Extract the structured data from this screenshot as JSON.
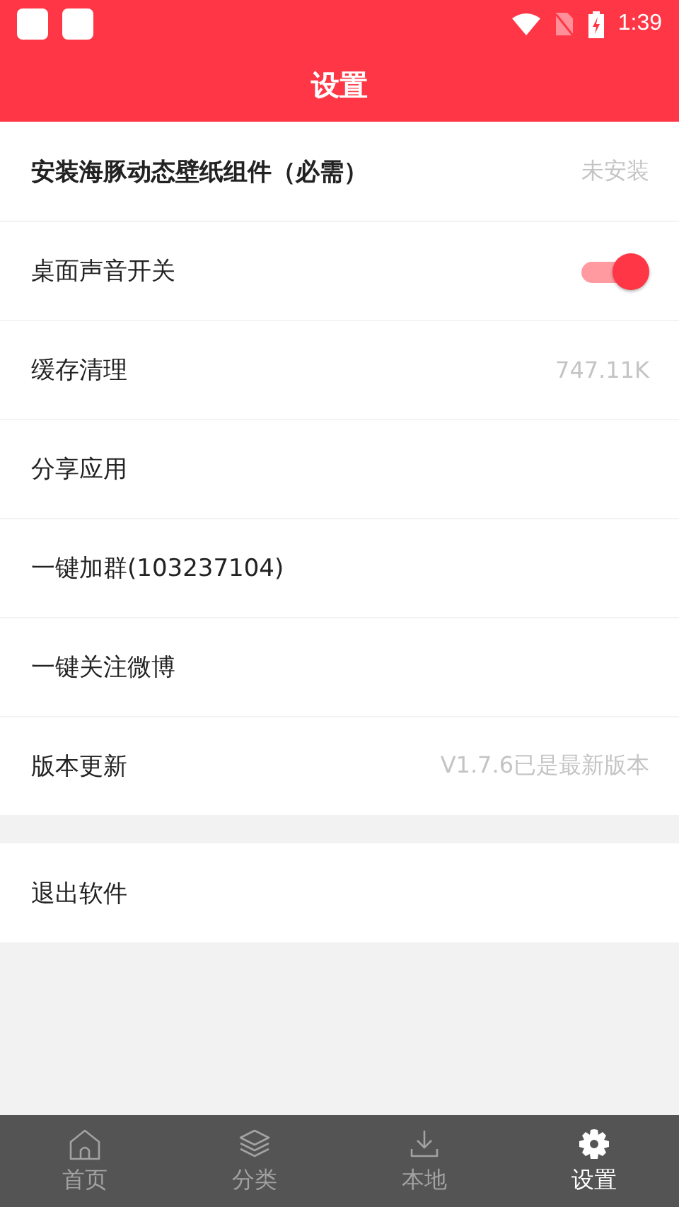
{
  "status_bar": {
    "time": "1:39"
  },
  "header": {
    "title": "设置"
  },
  "settings": [
    {
      "kind": "value",
      "label": "安装海豚动态壁纸组件（必需）",
      "bold": true,
      "value": "未安装"
    },
    {
      "kind": "toggle",
      "label": "桌面声音开关",
      "on": true
    },
    {
      "kind": "value",
      "label": "缓存清理",
      "value": "747.11K"
    },
    {
      "kind": "plain",
      "label": "分享应用"
    },
    {
      "kind": "plain",
      "label": "一键加群(103237104)"
    },
    {
      "kind": "plain",
      "label": "一键关注微博"
    },
    {
      "kind": "value",
      "label": "版本更新",
      "value": "V1.7.6已是最新版本"
    }
  ],
  "exit": {
    "label": "退出软件"
  },
  "tabs": [
    {
      "kind": "home",
      "label": "首页",
      "selected": false
    },
    {
      "kind": "layers",
      "label": "分类",
      "selected": false
    },
    {
      "kind": "download",
      "label": "本地",
      "selected": false
    },
    {
      "kind": "gear",
      "label": "设置",
      "selected": true
    }
  ]
}
